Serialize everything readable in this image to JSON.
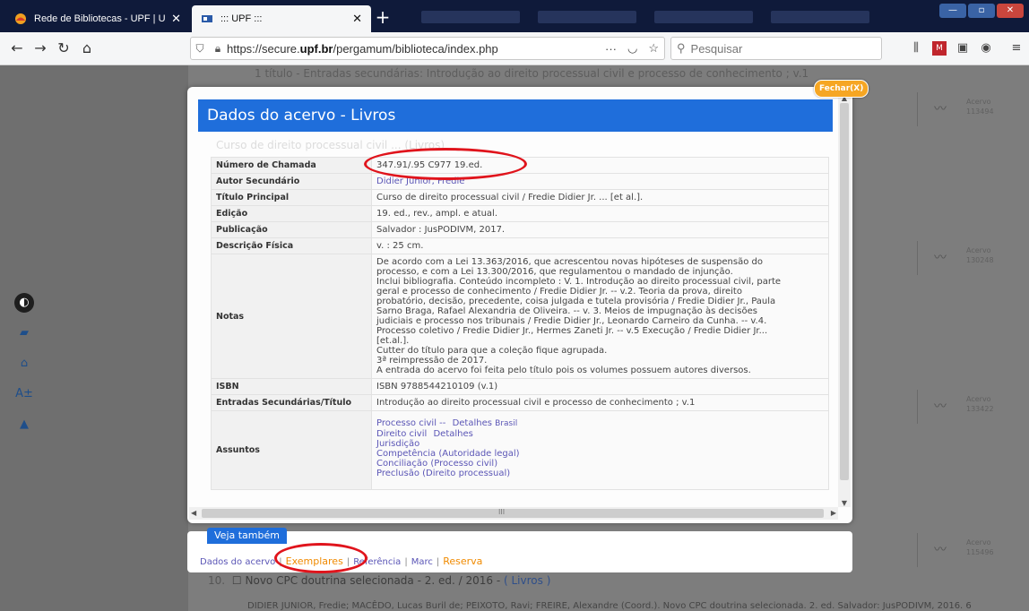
{
  "browser": {
    "tabs": [
      {
        "title": "Rede de Bibliotecas - UPF | Uni",
        "active": false
      },
      {
        "title": "::: UPF :::",
        "active": true
      }
    ],
    "url_prefix": "https://secure.",
    "url_domain": "upf.br",
    "url_path": "/pergamum/biblioteca/index.php",
    "search_placeholder": "Pesquisar",
    "more_label": "···"
  },
  "background": {
    "top_line": "1 título - Entradas secundárias: Introdução ao direito processual civil e processo de conhecimento ; v.1",
    "ghost_heading": "Curso de direito processual civil ... (Livros)",
    "acervo_label": "Acervo",
    "acervo_numbers": [
      "113494",
      "130248",
      "133422",
      "115496"
    ],
    "item": {
      "number": "10.",
      "title": "Novo CPC doutrina selecionada - 2. ed. / 2016 -",
      "tag": "( Livros )"
    },
    "bottom_line": "DIDIER JUNIOR, Fredie; MACÊDO, Lucas Buril de; PEIXOTO, Ravi; FREIRE, Alexandre (Coord.). Novo CPC doutrina selecionada. 2. ed. Salvador: JusPODIVM, 2016. 6"
  },
  "modal": {
    "close_label": "Fechar(X)",
    "title": "Dados do acervo - Livros",
    "fields": {
      "numero_chamada": {
        "label": "Número de Chamada",
        "value": "347.91/.95 C977 19.ed."
      },
      "autor_secundario": {
        "label": "Autor Secundário",
        "value": "Didier Junior, Fredie"
      },
      "titulo_principal": {
        "label": "Título Principal",
        "value": "Curso de direito processual civil / Fredie Didier Jr. ... [et al.]."
      },
      "edicao": {
        "label": "Edição",
        "value": "19. ed., rev., ampl. e atual."
      },
      "publicacao": {
        "label": "Publicação",
        "value": "Salvador : JusPODIVM, 2017."
      },
      "descricao_fisica": {
        "label": "Descrição Física",
        "value": "v. : 25 cm."
      },
      "notas": {
        "label": "Notas",
        "lines": [
          "De acordo com a Lei 13.363/2016, que acrescentou novas hipóteses de suspensão do",
          "processo, e com a Lei 13.300/2016, que regulamentou o mandado de injunção.",
          "Inclui bibliografia.  Conteúdo incompleto : V. 1. Introdução ao direito processual civil, parte",
          "geral e processo de conhecimento / Fredie Didier Jr. -- v.2. Teoria da prova, direito",
          "probatório, decisão, precedente, coisa julgada e tutela provisória / Fredie Didier Jr., Paula",
          "Sarno Braga, Rafael Alexandria de Oliveira. -- v. 3. Meios de impugnação às decisões",
          "judiciais e processo nos tribunais / Fredie Didier Jr., Leonardo Carneiro da Cunha. -- v.4.",
          "Processo coletivo / Fredie Didier Jr., Hermes Zaneti Jr. -- v.5 Execução / Fredie Didier Jr...",
          "[et.al.].",
          "Cutter do título para que a coleção fique agrupada.",
          "3ª reimpressão de 2017.",
          "A entrada do acervo foi feita pelo título pois os volumes possuem autores diversos."
        ]
      },
      "isbn": {
        "label": "ISBN",
        "value": "ISBN 9788544210109 (v.1)"
      },
      "entradas_secundarias": {
        "label": "Entradas Secundárias/Título",
        "value": "Introdução ao direito processual civil e processo de conhecimento ; v.1"
      },
      "assuntos": {
        "label": "Assuntos",
        "items": [
          {
            "text": "Processo civil --",
            "detail": "Detalhes",
            "extra": "Brasil"
          },
          {
            "text": "Direito civil",
            "detail": "Detalhes",
            "extra": ""
          },
          {
            "text": "Jurisdição",
            "detail": "",
            "extra": ""
          },
          {
            "text": "Competência (Autoridade legal)",
            "detail": "",
            "extra": ""
          },
          {
            "text": "Conciliação (Processo civil)",
            "detail": "",
            "extra": ""
          },
          {
            "text": "Preclusão (Direito processual)",
            "detail": "",
            "extra": ""
          }
        ]
      }
    },
    "hscroll_grip": "III"
  },
  "see_also": {
    "tab_label": "Veja também",
    "links": {
      "dados": "Dados do acervo",
      "exemplares": "Exemplares",
      "referencia": "Referência",
      "marc": "Marc",
      "reserva": "Reserva"
    },
    "separator": "|"
  },
  "colors": {
    "header_blue": "#1f6edb",
    "close_orange": "#f6a623",
    "annotation_red": "#e0141c",
    "link_purple": "#5b56b6",
    "link_orange": "#f08a00"
  }
}
